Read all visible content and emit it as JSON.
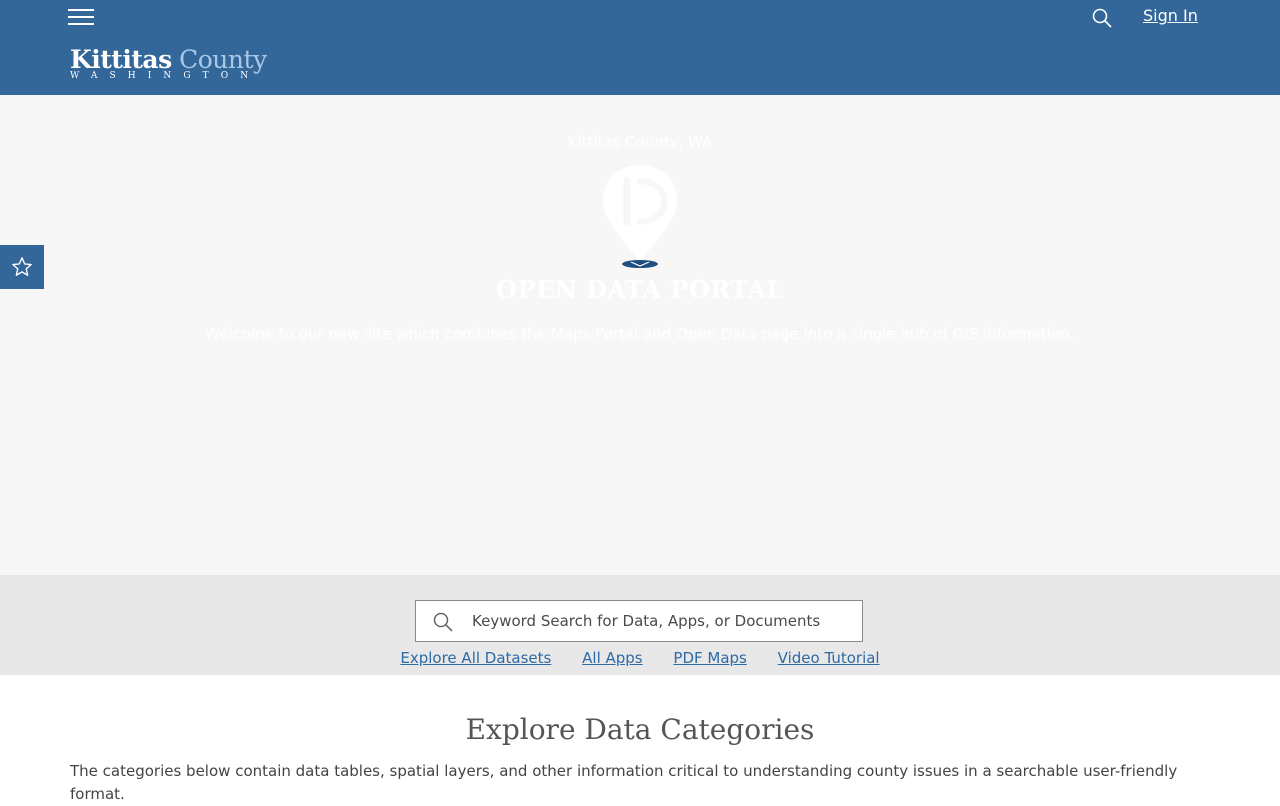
{
  "header": {
    "logo_primary_word1": "Kittitas",
    "logo_primary_word2": "County",
    "logo_secondary": "WASHINGTON",
    "signin_label": "Sign In",
    "bg_color": "#336699"
  },
  "hero": {
    "subtitle": "Kittitas County, WA",
    "title": "OPEN DATA PORTAL",
    "welcome": "Welcome to our new site which combines the Maps Portal and Open Data page into a single hub of GIS information."
  },
  "search": {
    "placeholder": "Keyword Search for Data, Apps, or Documents"
  },
  "quick_links": [
    {
      "label": "Explore All Datasets"
    },
    {
      "label": "All Apps"
    },
    {
      "label": "PDF Maps"
    },
    {
      "label": "Video Tutorial"
    }
  ],
  "categories": {
    "title": "Explore Data Categories",
    "description": "The categories below contain data tables, spatial layers, and other information critical to understanding county issues in a searchable user-friendly format."
  },
  "icons": {
    "menu": "hamburger-icon",
    "search": "search-icon",
    "favorite": "star-icon",
    "hero": "map-pin-icon"
  }
}
